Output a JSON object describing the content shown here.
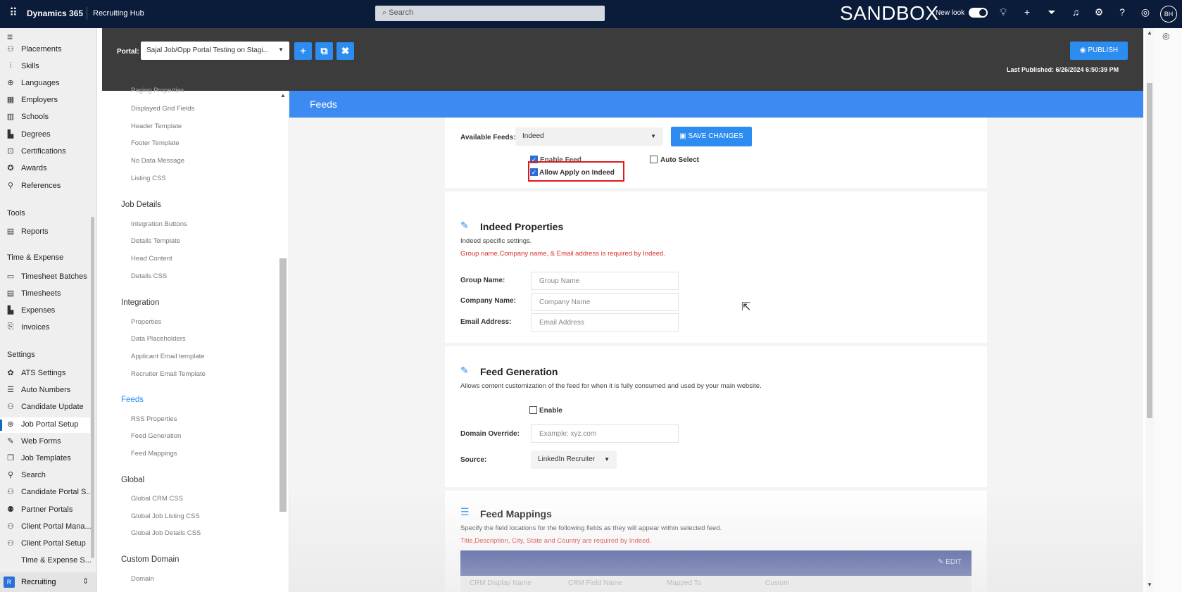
{
  "topbar": {
    "brand": "Dynamics 365",
    "app": "Recruiting Hub",
    "search_placeholder": "Search",
    "environment": "SANDBOX",
    "new_look_label": "New look",
    "avatar_initials": "BH"
  },
  "leftnav": {
    "items_top": [
      {
        "label": "Placements",
        "icon": "placements-icon"
      },
      {
        "label": "Skills",
        "icon": "skills-icon"
      },
      {
        "label": "Languages",
        "icon": "languages-icon"
      },
      {
        "label": "Employers",
        "icon": "employers-icon"
      },
      {
        "label": "Schools",
        "icon": "schools-icon"
      },
      {
        "label": "Degrees",
        "icon": "degrees-icon"
      },
      {
        "label": "Certifications",
        "icon": "certifications-icon"
      },
      {
        "label": "Awards",
        "icon": "awards-icon"
      },
      {
        "label": "References",
        "icon": "references-icon"
      }
    ],
    "tools_heading": "Tools",
    "tools_items": [
      {
        "label": "Reports"
      }
    ],
    "time_heading": "Time & Expense",
    "time_items": [
      {
        "label": "Timesheet Batches"
      },
      {
        "label": "Timesheets"
      },
      {
        "label": "Expenses"
      },
      {
        "label": "Invoices"
      }
    ],
    "settings_heading": "Settings",
    "settings_items": [
      {
        "label": "ATS Settings"
      },
      {
        "label": "Auto Numbers"
      },
      {
        "label": "Candidate Update"
      },
      {
        "label": "Job Portal Setup"
      },
      {
        "label": "Web Forms"
      },
      {
        "label": "Job Templates"
      },
      {
        "label": "Search"
      },
      {
        "label": "Candidate Portal S..."
      },
      {
        "label": "Partner Portals"
      },
      {
        "label": "Client Portal Mana..."
      },
      {
        "label": "Client Portal Setup"
      },
      {
        "label": "Time & Expense S..."
      }
    ],
    "area_badge": "R",
    "area_label": "Recruiting"
  },
  "portal": {
    "label": "Portal:",
    "selected": "Sajal Job/Opp Portal Testing on Stagi...",
    "publish_label": "PUBLISH",
    "last_published": "Last Published: 6/26/2024 6:50:39 PM"
  },
  "sections": {
    "top_items": [
      "Paging Properties",
      "Displayed Grid Fields",
      "Header Template",
      "Footer Template",
      "No Data Message",
      "Listing CSS"
    ],
    "job_details_heading": "Job Details",
    "job_details_items": [
      "Integration Buttons",
      "Details Template",
      "Head Content",
      "Details CSS"
    ],
    "integration_heading": "Integration",
    "integration_items": [
      "Properties",
      "Data Placeholders",
      "Applicant Email template",
      "Recruiter Email Template"
    ],
    "feeds_heading": "Feeds",
    "feeds_items": [
      "RSS Properties",
      "Feed Generation",
      "Feed Mappings"
    ],
    "global_heading": "Global",
    "global_items": [
      "Global CRM CSS",
      "Global Job Listing CSS",
      "Global Job Details CSS"
    ],
    "custom_domain_heading": "Custom Domain",
    "custom_domain_items": [
      "Domain"
    ]
  },
  "main": {
    "title": "Feeds",
    "available_feeds_label": "Available Feeds:",
    "available_feeds_value": "Indeed",
    "save_label": "SAVE CHANGES",
    "enable_feed_label": "Enable Feed",
    "auto_select_label": "Auto Select",
    "allow_apply_label": "Allow Apply on Indeed",
    "indeed": {
      "title": "Indeed Properties",
      "desc": "Indeed specific settings.",
      "error": "Group name,Company name, & Email address is required by Indeed.",
      "group_label": "Group Name:",
      "group_placeholder": "Group Name",
      "company_label": "Company Name:",
      "company_placeholder": "Company Name",
      "email_label": "Email Address:",
      "email_placeholder": "Email Address"
    },
    "generation": {
      "title": "Feed Generation",
      "desc": "Allows content customization of the feed for when it is fully consumed and used by your main website.",
      "enable_label": "Enable",
      "domain_label": "Domain Override:",
      "domain_placeholder": "Example: xyz.com",
      "source_label": "Source:",
      "source_value": "LinkedIn Recruiter"
    },
    "mappings": {
      "title": "Feed Mappings",
      "desc": "Specify the field locations for the following fields as they will appear within selected feed.",
      "error": "Title,Description, City, State and Country are required by Indeed.",
      "edit_label": "EDIT",
      "columns": [
        "CRM Display Name",
        "CRM Field Name",
        "Mapped To",
        "Custom"
      ]
    }
  },
  "colors": {
    "topbar": "#0b1b3a",
    "accent": "#2d8cf0",
    "feeds_bar": "#3d8bf2",
    "table_header": "#2c3e8f",
    "error": "#d9302a",
    "highlight": "#e0191d"
  }
}
